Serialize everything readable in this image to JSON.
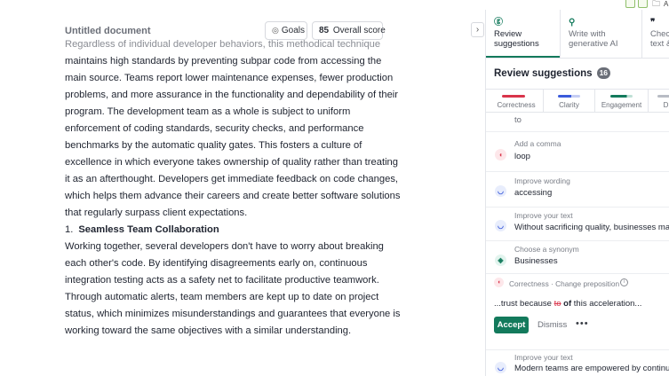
{
  "top_strip": {
    "folder_icon": "folder-icon",
    "folder_label": "A"
  },
  "document": {
    "title": "Untitled document",
    "goals_label": "Goals",
    "score_value": "85",
    "score_label": "Overall score",
    "paragraph1_first_line": "Regardless of individual developer behaviors, this methodical technique",
    "paragraph1": "maintains high standards by preventing subpar code from accessing the main source. Teams report lower maintenance expenses, fewer production problems, and more assurance in the functionality and dependability of their program. The development team as a whole is subject to uniform enforcement of coding standards, security checks, and performance benchmarks by the automatic quality gates. This fosters a culture of excellence in which everyone takes ownership of quality rather than treating it as an afterthought. Developers get immediate feedback on code changes, which helps them advance their careers and create better software solutions that regularly surpass client expectations.",
    "list_number": "1.",
    "list_item": "Seamless Team Collaboration",
    "paragraph2": "Working together, several developers don't have to worry about breaking each other's code. By identifying disagreements early on, continuous integration testing acts as a safety net to facilitate productive teamwork. Through automatic alerts, team members are kept up to date on project status, which minimizes misunderstandings and guarantees that everyone is working toward the same objectives with a similar understanding."
  },
  "sidebar": {
    "tabs": [
      {
        "label_line1": "Review",
        "label_line2": "suggestions",
        "icon": "grammarly-icon"
      },
      {
        "label_line1": "Write with",
        "label_line2": "generative AI",
        "icon": "pin-icon"
      },
      {
        "label_line1": "Check fo",
        "label_line2": "text & p",
        "icon": "quote-icon"
      }
    ],
    "header_title": "Review suggestions",
    "count": "16",
    "categories": [
      {
        "label": "Correctness",
        "color": "#d9344a"
      },
      {
        "label": "Clarity",
        "color": "#3b5bdb"
      },
      {
        "label": "Engagement",
        "color": "#137a5c"
      },
      {
        "label": "D",
        "color": "#b8bcc4"
      }
    ],
    "cards": [
      {
        "type": "",
        "text": "to"
      },
      {
        "type": "Add a comma",
        "text": "loop"
      },
      {
        "type": "Improve wording",
        "text": "accessing"
      },
      {
        "type": "Improve your text",
        "text": "Without sacrificing quality, businesses may r"
      },
      {
        "type": "Choose a synonym",
        "text": "Businesses"
      }
    ],
    "expanded": {
      "type": "Correctness · Change preposition",
      "info_icon": "info-icon",
      "sentence_before": "...trust because ",
      "deleted": "to",
      "inserted": "of",
      "sentence_after": " this acceleration...",
      "accept_label": "Accept",
      "dismiss_label": "Dismiss",
      "more_label": "•••"
    },
    "last_card": {
      "type": "Improve your text",
      "text": "Modern teams are empowered by continuou"
    }
  }
}
